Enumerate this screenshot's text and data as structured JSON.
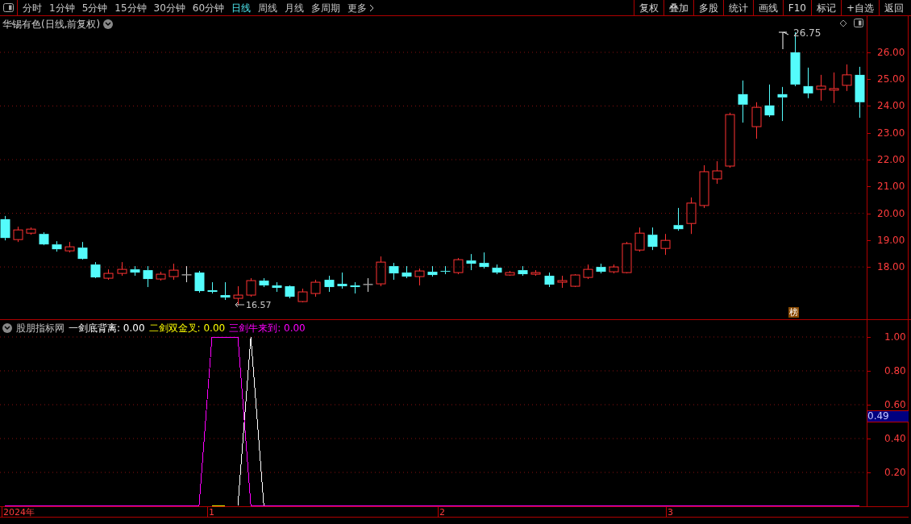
{
  "toolbar": {
    "periods": [
      {
        "label": "分时",
        "selected": false
      },
      {
        "label": "1分钟",
        "selected": false
      },
      {
        "label": "5分钟",
        "selected": false
      },
      {
        "label": "15分钟",
        "selected": false
      },
      {
        "label": "30分钟",
        "selected": false
      },
      {
        "label": "60分钟",
        "selected": false
      },
      {
        "label": "日线",
        "selected": true
      },
      {
        "label": "周线",
        "selected": false
      },
      {
        "label": "月线",
        "selected": false
      },
      {
        "label": "多周期",
        "selected": false
      },
      {
        "label": "更多",
        "selected": false
      }
    ],
    "buttons": [
      "复权",
      "叠加",
      "多股",
      "统计",
      "画线",
      "F10",
      "标记",
      "+自选",
      "返回"
    ]
  },
  "price_chart": {
    "title": "华锡有色(日线,前复权)",
    "high_label": "26.75",
    "low_label": "16.57",
    "badge": "榜",
    "chart_data": {
      "type": "candlestick",
      "ylim": [
        16.05,
        27.35
      ],
      "yticks": [
        {
          "value": 26,
          "label": "26.00"
        },
        {
          "value": 25,
          "label": "25.00"
        },
        {
          "value": 24,
          "label": "24.00"
        },
        {
          "value": 23,
          "label": "23.00"
        },
        {
          "value": 22,
          "label": "22.00"
        },
        {
          "value": 21,
          "label": "21.00"
        },
        {
          "value": 20,
          "label": "20.00"
        },
        {
          "value": 19,
          "label": "19.00"
        },
        {
          "value": 18,
          "label": "18.00"
        }
      ],
      "grid": true,
      "ohlc": [
        [
          19.78,
          19.9,
          18.99,
          19.08
        ],
        [
          19.02,
          19.5,
          18.93,
          19.38
        ],
        [
          19.26,
          19.47,
          19.2,
          19.41
        ],
        [
          19.23,
          19.29,
          18.81,
          18.84
        ],
        [
          18.84,
          18.96,
          18.57,
          18.66
        ],
        [
          18.6,
          18.93,
          18.54,
          18.75
        ],
        [
          18.72,
          18.93,
          18.27,
          18.3
        ],
        [
          18.09,
          18.18,
          17.58,
          17.61
        ],
        [
          17.58,
          17.91,
          17.52,
          17.76
        ],
        [
          17.76,
          18.18,
          17.67,
          17.91
        ],
        [
          17.91,
          18.03,
          17.67,
          17.79
        ],
        [
          17.88,
          18.03,
          17.25,
          17.55
        ],
        [
          17.55,
          17.82,
          17.49,
          17.73
        ],
        [
          17.64,
          18.12,
          17.52,
          17.88
        ],
        [
          17.72,
          18.03,
          17.43,
          17.72
        ],
        [
          17.79,
          17.85,
          17.04,
          17.1
        ],
        [
          17.13,
          17.43,
          17.01,
          17.07
        ],
        [
          16.95,
          17.43,
          16.77,
          16.86
        ],
        [
          16.83,
          17.28,
          16.57,
          16.95
        ],
        [
          16.95,
          17.58,
          16.89,
          17.49
        ],
        [
          17.49,
          17.58,
          17.25,
          17.31
        ],
        [
          17.31,
          17.43,
          17.07,
          17.22
        ],
        [
          17.28,
          17.31,
          16.83,
          16.89
        ],
        [
          16.71,
          17.19,
          16.68,
          17.07
        ],
        [
          17.01,
          17.52,
          16.89,
          17.43
        ],
        [
          17.52,
          17.67,
          17.07,
          17.25
        ],
        [
          17.37,
          17.79,
          17.19,
          17.28
        ],
        [
          17.31,
          17.43,
          17.01,
          17.25
        ],
        [
          17.36,
          17.58,
          17.07,
          17.36
        ],
        [
          17.37,
          18.39,
          17.28,
          18.18
        ],
        [
          18.03,
          18.15,
          17.52,
          17.76
        ],
        [
          17.79,
          18.03,
          17.58,
          17.64
        ],
        [
          17.64,
          17.94,
          17.31,
          17.85
        ],
        [
          17.82,
          18.03,
          17.64,
          17.7
        ],
        [
          17.85,
          18.03,
          17.73,
          17.82
        ],
        [
          17.79,
          18.33,
          17.73,
          18.27
        ],
        [
          18.24,
          18.48,
          17.88,
          18.12
        ],
        [
          18.15,
          18.54,
          17.94,
          18.0
        ],
        [
          17.97,
          18.09,
          17.73,
          17.79
        ],
        [
          17.7,
          17.85,
          17.67,
          17.79
        ],
        [
          17.88,
          18.03,
          17.67,
          17.73
        ],
        [
          17.73,
          17.88,
          17.67,
          17.79
        ],
        [
          17.67,
          17.79,
          17.25,
          17.34
        ],
        [
          17.43,
          17.67,
          17.22,
          17.49
        ],
        [
          17.28,
          17.73,
          17.25,
          17.7
        ],
        [
          17.61,
          18.09,
          17.55,
          17.91
        ],
        [
          18.0,
          18.12,
          17.76,
          17.82
        ],
        [
          17.82,
          18.09,
          17.76,
          18.0
        ],
        [
          17.79,
          18.93,
          17.76,
          18.87
        ],
        [
          18.63,
          19.47,
          18.57,
          19.26
        ],
        [
          19.2,
          19.47,
          18.63,
          18.75
        ],
        [
          18.69,
          19.23,
          18.45,
          18.99
        ],
        [
          19.56,
          20.2,
          19.35,
          19.41
        ],
        [
          19.62,
          20.59,
          19.23,
          20.38
        ],
        [
          20.29,
          21.79,
          20.2,
          21.55
        ],
        [
          21.28,
          21.94,
          21.1,
          21.58
        ],
        [
          21.76,
          23.75,
          21.7,
          23.68
        ],
        [
          24.44,
          24.95,
          23.38,
          24.05
        ],
        [
          23.23,
          24.14,
          22.78,
          23.95
        ],
        [
          24.02,
          24.8,
          23.59,
          23.65
        ],
        [
          24.44,
          24.71,
          23.44,
          24.32
        ],
        [
          26.0,
          26.75,
          24.74,
          24.8
        ],
        [
          24.74,
          25.43,
          24.29,
          24.47
        ],
        [
          24.62,
          25.16,
          24.2,
          24.74
        ],
        [
          24.59,
          25.25,
          24.11,
          24.65
        ],
        [
          24.77,
          25.55,
          24.56,
          25.16
        ],
        [
          25.16,
          25.46,
          23.56,
          24.14
        ]
      ]
    }
  },
  "indicator": {
    "name": "股朋指标网",
    "legend": [
      {
        "separator": ":",
        "value": "0.00"
      },
      {
        "separator": ":",
        "value": "0.00"
      },
      {
        "separator": ":",
        "value": "0.00"
      }
    ],
    "current_value": "0.49",
    "chart_data": {
      "type": "line",
      "grid": true,
      "ylim": [
        0,
        1.1
      ],
      "yticks": [
        {
          "value": 0.2,
          "label": "0.20"
        },
        {
          "value": 0.4,
          "label": "0.40"
        },
        {
          "value": 0.6,
          "label": "0.60"
        },
        {
          "value": 0.8,
          "label": "0.80"
        },
        {
          "value": 1.0,
          "label": "1.00"
        }
      ],
      "series": [
        {
          "name": "一剑底背离",
          "color": "#ffffff",
          "values": [
            null,
            null,
            null,
            null,
            null,
            null,
            null,
            null,
            null,
            null,
            null,
            null,
            null,
            null,
            null,
            null,
            null,
            null,
            0,
            1,
            0,
            null,
            null,
            null,
            null,
            null,
            null,
            null,
            null,
            null,
            null,
            null,
            null,
            null,
            null,
            null,
            null,
            null,
            null,
            null,
            null,
            null,
            null,
            null,
            null,
            null,
            null,
            null,
            null,
            null,
            null,
            null,
            null,
            null,
            null,
            null,
            null,
            null,
            null,
            null,
            null,
            null,
            null,
            null,
            null,
            null,
            null
          ]
        },
        {
          "name": "二剑双金叉",
          "color": "#ffff00",
          "values": [
            null,
            null,
            null,
            null,
            null,
            null,
            null,
            null,
            null,
            null,
            null,
            null,
            null,
            null,
            null,
            null,
            0,
            0,
            null,
            null,
            null,
            null,
            null,
            null,
            null,
            null,
            null,
            null,
            null,
            null,
            null,
            null,
            null,
            null,
            null,
            null,
            null,
            null,
            null,
            null,
            null,
            null,
            null,
            null,
            null,
            null,
            null,
            null,
            null,
            null,
            null,
            null,
            null,
            null,
            null,
            null,
            null,
            null,
            null,
            null,
            null,
            null,
            null,
            null,
            null,
            null,
            null
          ]
        },
        {
          "name": "三剑牛来到",
          "color": "#ff00ff",
          "values": [
            0,
            0,
            0,
            0,
            0,
            0,
            0,
            0,
            0,
            0,
            0,
            0,
            0,
            0,
            0,
            0,
            1,
            1,
            1,
            0,
            0,
            0,
            0,
            0,
            0,
            0,
            0,
            0,
            0,
            0,
            0,
            0,
            0,
            0,
            0,
            0,
            0,
            0,
            0,
            0,
            0,
            0,
            0,
            0,
            0,
            0,
            0,
            0,
            0,
            0,
            0,
            0,
            0,
            0,
            0,
            0,
            0,
            0,
            0,
            0,
            0,
            0,
            0,
            0,
            0,
            0,
            0
          ]
        }
      ]
    }
  },
  "date_axis": [
    "2024年",
    "1",
    "2",
    "3"
  ]
}
